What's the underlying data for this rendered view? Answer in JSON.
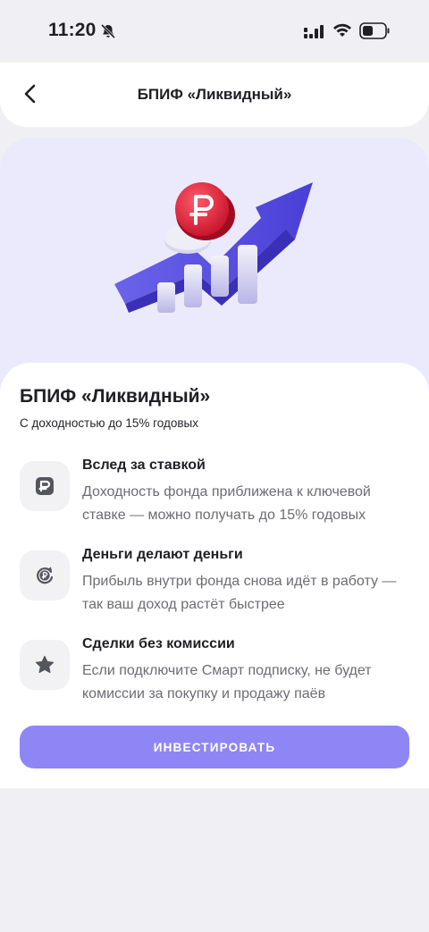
{
  "status_bar": {
    "time": "11:20",
    "icons": [
      "bell-muted-icon",
      "signal-icon",
      "wifi-icon",
      "battery-icon"
    ]
  },
  "header": {
    "back_icon": "chevron-left-icon",
    "title": "БПИФ «Ликвидный»"
  },
  "hero": {
    "illustration": "growth-arrow-with-ruble-coin",
    "colors": {
      "background": "#ebeafd",
      "arrow": "#5a50e0",
      "coin": "#e8263a"
    }
  },
  "card": {
    "title": "БПИФ «Ликвидный»",
    "subtitle": "С доходностью до 15% годовых",
    "features": [
      {
        "icon": "rate-icon",
        "title": "Вслед за ставкой",
        "text": "Доходность фонда приближена к ключевой ставке — можно получать до 15% годовых"
      },
      {
        "icon": "ruble-cycle-icon",
        "title": "Деньги делают деньги",
        "text": "Прибыль внутри фонда снова идёт в работу — так ваш доход растёт быстрее"
      },
      {
        "icon": "star-icon",
        "title": "Сделки без комиссии",
        "text": "Если подключите Смарт подписку, не будет комиссии за покупку и продажу паёв"
      }
    ],
    "invest_button": "ИНВЕСТИРОВАТЬ"
  },
  "theme": {
    "accent": "#8f86f5",
    "page_bg": "#f0f0f4"
  }
}
